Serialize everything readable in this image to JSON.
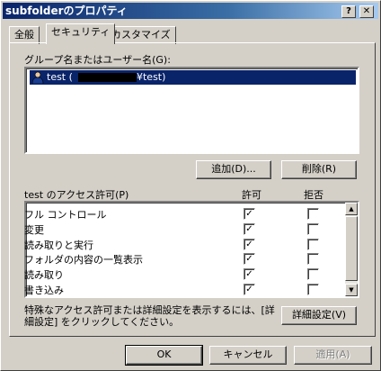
{
  "window": {
    "title": "subfolderのプロパティ",
    "help_label": "?",
    "close_label": "✕"
  },
  "tabs": [
    {
      "label": "全般"
    },
    {
      "label": "セキュリティ"
    },
    {
      "label": "カスタマイズ"
    }
  ],
  "users": {
    "label": "グループ名またはユーザー名(G):",
    "items": [
      {
        "name": "test (",
        "suffix": "¥test)",
        "selected": true
      }
    ],
    "add_button": "追加(D)...",
    "remove_button": "削除(R)"
  },
  "permissions": {
    "label": "test のアクセス許可(P)",
    "allow_header": "許可",
    "deny_header": "拒否",
    "rows": [
      {
        "name": "フル コントロール",
        "allow": true,
        "deny": false
      },
      {
        "name": "変更",
        "allow": true,
        "deny": false
      },
      {
        "name": "読み取りと実行",
        "allow": true,
        "deny": false
      },
      {
        "name": "フォルダの内容の一覧表示",
        "allow": true,
        "deny": false
      },
      {
        "name": "読み取り",
        "allow": true,
        "deny": false
      },
      {
        "name": "書き込み",
        "allow": true,
        "deny": false
      }
    ]
  },
  "advanced": {
    "text_line1": "特殊なアクセス許可または詳細設定を表示するには、[詳",
    "text_line2": "細設定] をクリックしてください。",
    "button": "詳細設定(V)"
  },
  "footer": {
    "ok": "OK",
    "cancel": "キャンセル",
    "apply": "適用(A)"
  },
  "icons": {
    "user": "user-icon",
    "check": "✓",
    "up": "▲",
    "down": "▼"
  }
}
